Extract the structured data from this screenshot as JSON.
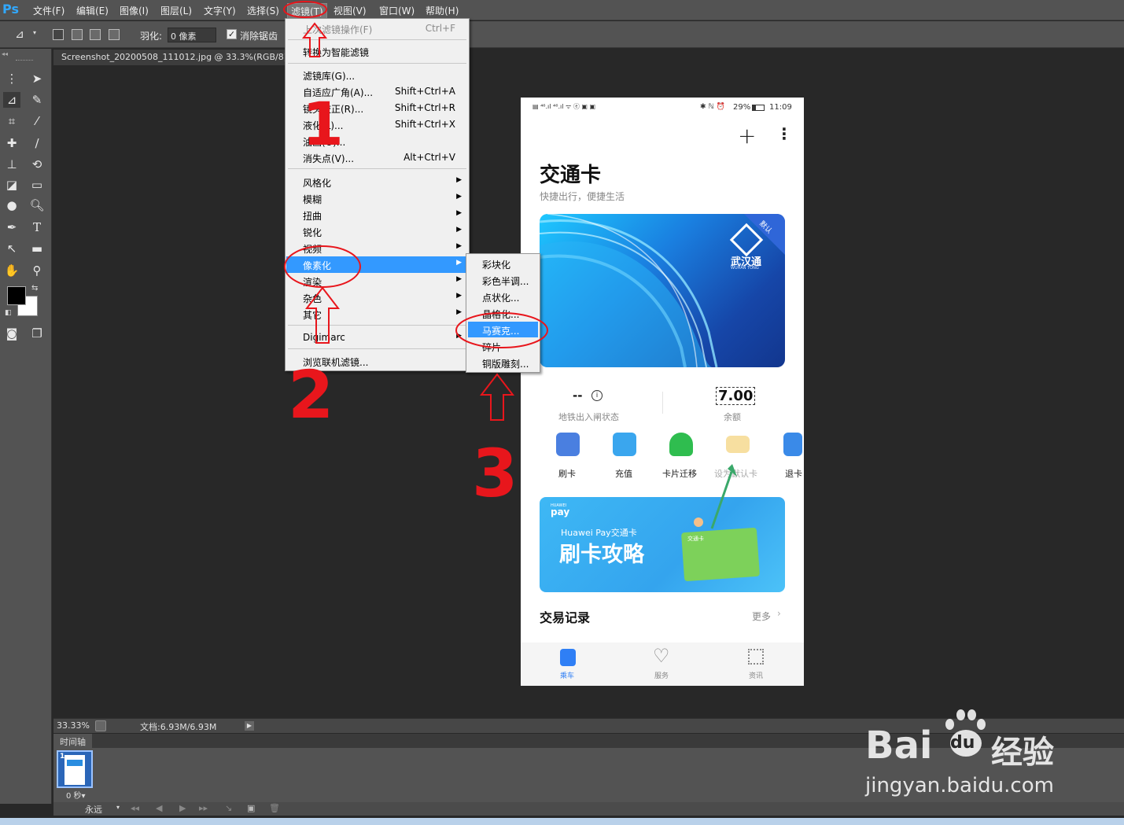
{
  "app": {
    "logo": "Ps"
  },
  "menubar": {
    "items": [
      "文件(F)",
      "编辑(E)",
      "图像(I)",
      "图层(L)",
      "文字(Y)",
      "选择(S)",
      "滤镜(T)",
      "视图(V)",
      "窗口(W)",
      "帮助(H)"
    ]
  },
  "options": {
    "feather_label": "羽化:",
    "feather_value": "0 像素",
    "antialias_label": "消除锯齿"
  },
  "document": {
    "tab_title": "Screenshot_20200508_111012.jpg @ 33.3%(RGB/8)",
    "zoom": "33.33%",
    "doc_size": "文档:6.93M/6.93M"
  },
  "timeline": {
    "title": "时间轴",
    "frame_number": "1",
    "frame_delay": "0 秒▾",
    "loop": "永远"
  },
  "filter_menu": {
    "items": [
      {
        "label": "上次滤镜操作(F)",
        "shortcut": "Ctrl+F",
        "disabled": true
      },
      {
        "label": "转换为智能滤镜",
        "shortcut": ""
      },
      {
        "label": "滤镜库(G)...",
        "shortcut": ""
      },
      {
        "label": "自适应广角(A)...",
        "shortcut": "Shift+Ctrl+A"
      },
      {
        "label": "镜头校正(R)...",
        "shortcut": "Shift+Ctrl+R"
      },
      {
        "label": "液化(L)...",
        "shortcut": "Shift+Ctrl+X"
      },
      {
        "label": "油画(O)...",
        "shortcut": ""
      },
      {
        "label": "消失点(V)...",
        "shortcut": "Alt+Ctrl+V"
      },
      {
        "label": "风格化",
        "submenu": true
      },
      {
        "label": "模糊",
        "submenu": true
      },
      {
        "label": "扭曲",
        "submenu": true
      },
      {
        "label": "锐化",
        "submenu": true
      },
      {
        "label": "视频",
        "submenu": true
      },
      {
        "label": "像素化",
        "submenu": true,
        "highlighted": true
      },
      {
        "label": "渲染",
        "submenu": true
      },
      {
        "label": "杂色",
        "submenu": true
      },
      {
        "label": "其它",
        "submenu": true
      },
      {
        "label": "Digimarc",
        "submenu": true
      },
      {
        "label": "浏览联机滤镜...",
        "shortcut": ""
      }
    ]
  },
  "pixelate_submenu": {
    "items": [
      "彩块化",
      "彩色半调...",
      "点状化...",
      "晶格化...",
      "马赛克...",
      "碎片",
      "铜版雕刻..."
    ],
    "highlighted_index": 4
  },
  "phone": {
    "status_right": "29%",
    "time": "11:09",
    "title": "交通卡",
    "subtitle": "快捷出行，便捷生活",
    "card": {
      "badge": "默认",
      "brand": "武汉通",
      "brand_en": "WUHAN TONG"
    },
    "metro_status_value": "--",
    "metro_status_label": "地铁出入闸状态",
    "balance_value": "7.00",
    "balance_label": "余额",
    "actions": [
      {
        "label": "刷卡",
        "color": "#4a7fe0"
      },
      {
        "label": "充值",
        "color": "#3aa6ee"
      },
      {
        "label": "卡片迁移",
        "color": "#2fbd4f"
      },
      {
        "label": "设为默认卡",
        "color": "#f7dfa0",
        "disabled": true
      },
      {
        "label": "退卡",
        "color": "#3a8ae8"
      }
    ],
    "banner": {
      "brand_small": "HUAWEI",
      "brand": "pay",
      "line1": "Huawei Pay交通卡",
      "line2": "刷卡攻略",
      "card_label": "交通卡"
    },
    "records_title": "交易记录",
    "records_more": "更多",
    "nav": [
      {
        "label": "乘车",
        "active": true
      },
      {
        "label": "服务"
      },
      {
        "label": "资讯"
      }
    ]
  },
  "annotations": {
    "n1": "1",
    "n2": "2",
    "n3": "3"
  },
  "watermark": {
    "brand": "Bai",
    "brand2": "du",
    "cn": "经验",
    "url": "jingyan.baidu.com"
  },
  "colors": {
    "accent": "#3399ff",
    "annotation_red": "#e8161c",
    "ps_ui": "#535353"
  }
}
